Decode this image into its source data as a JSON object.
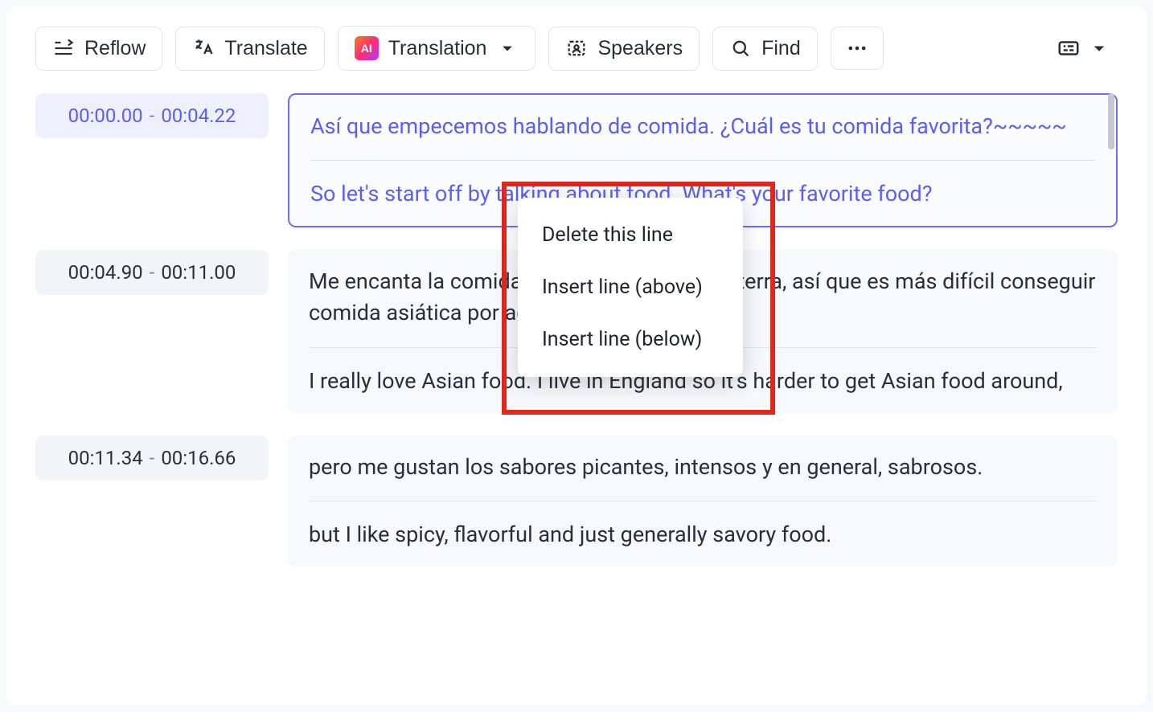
{
  "toolbar": {
    "reflow": "Reflow",
    "translate": "Translate",
    "translation": "Translation",
    "speakers": "Speakers",
    "find": "Find"
  },
  "context_menu": {
    "delete_line": "Delete this line",
    "insert_above": "Insert line (above)",
    "insert_below": "Insert line (below)"
  },
  "segments": [
    {
      "start": "00:00.00",
      "end": "00:04.22",
      "src": "Así que empecemos hablando de comida. ¿Cuál es tu comida favorita?~~~~~",
      "tgt": "So let's start off by talking about food. What's your favorite food?",
      "active": true
    },
    {
      "start": "00:04.90",
      "end": "00:11.00",
      "src": "Me encanta la comida asiática. Vivo en Inglaterra, así que es más difícil conseguir comida asiática por aquí,",
      "tgt": "I really love Asian food. I live in England so it's harder to get Asian food around,",
      "active": false
    },
    {
      "start": "00:11.34",
      "end": "00:16.66",
      "src": "pero me gustan los sabores picantes, intensos y en general, sabrosos.",
      "tgt": "but I like spicy, flavorful and just generally savory food.",
      "active": false
    }
  ]
}
